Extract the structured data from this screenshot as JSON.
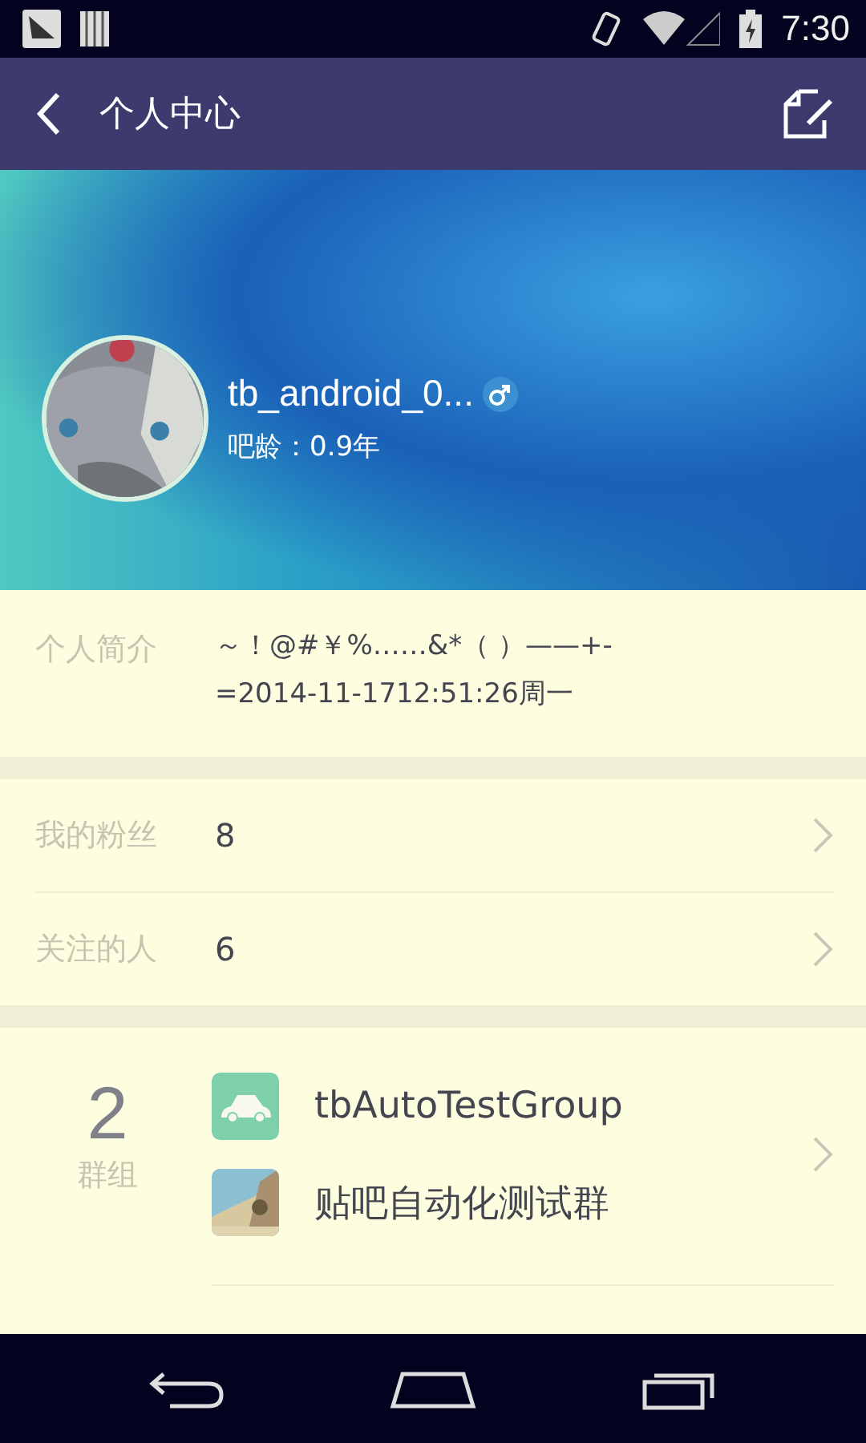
{
  "status_bar": {
    "time": "7:30"
  },
  "header": {
    "title": "个人中心"
  },
  "profile": {
    "username": "tb_android_0...",
    "age_label": "吧龄：0.9年"
  },
  "intro": {
    "label": "个人简介",
    "text": "～！@#￥%……&*（ ）——+-=2014-11-1712:51:26周一"
  },
  "stats": [
    {
      "label": "我的粉丝",
      "value": "8"
    },
    {
      "label": "关注的人",
      "value": "6"
    }
  ],
  "groups": {
    "count": "2",
    "label": "群组",
    "items": [
      {
        "name": "tbAutoTestGroup",
        "kind": "car"
      },
      {
        "name": "贴吧自动化测试群",
        "kind": "picture"
      }
    ]
  }
}
